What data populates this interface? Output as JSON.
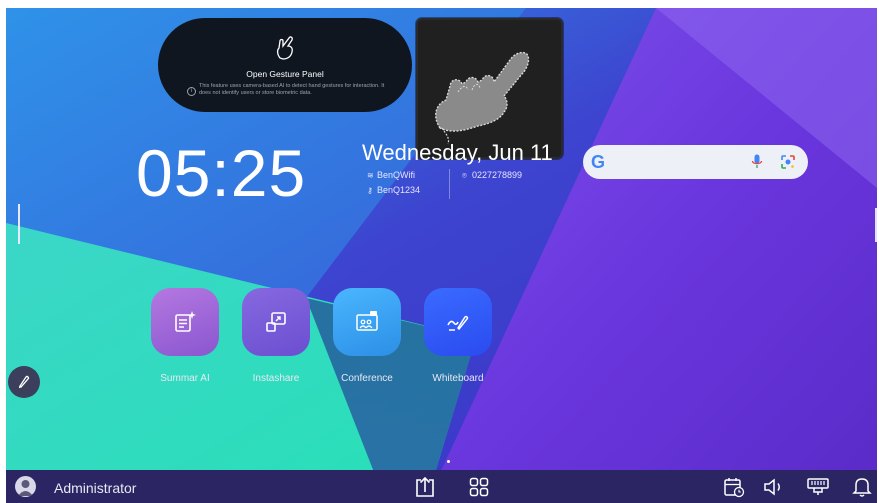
{
  "gesture_panel": {
    "title": "Open Gesture Panel",
    "note": "This feature uses camera-based AI to detect hand gestures for interaction. It does not identify users or store biometric data.",
    "info_glyph": "i"
  },
  "home": {
    "time": "05:25",
    "date": "Wednesday, Jun 11",
    "wifi_name": "BenQWifi",
    "wifi_password": "BenQ1234",
    "ip_address": "0227278899"
  },
  "search": {
    "logo": "G"
  },
  "apps": [
    {
      "label": "Summar AI",
      "icon": "summary-ai-icon"
    },
    {
      "label": "Instashare",
      "icon": "screen-cast-icon"
    },
    {
      "label": "Conference",
      "icon": "conference-icon"
    },
    {
      "label": "Whiteboard",
      "icon": "whiteboard-pen-icon"
    }
  ],
  "taskbar": {
    "user_name": "Administrator",
    "icons": [
      "share-icon",
      "apps-grid-icon",
      "schedule-icon",
      "volume-icon",
      "network-icon",
      "bell-icon"
    ]
  },
  "colors": {
    "wallpaper_blue": "#3c35c9",
    "wallpaper_teal": "#2ee0c0",
    "wallpaper_purple": "#6d2fd8",
    "taskbar": "#2b2663"
  }
}
